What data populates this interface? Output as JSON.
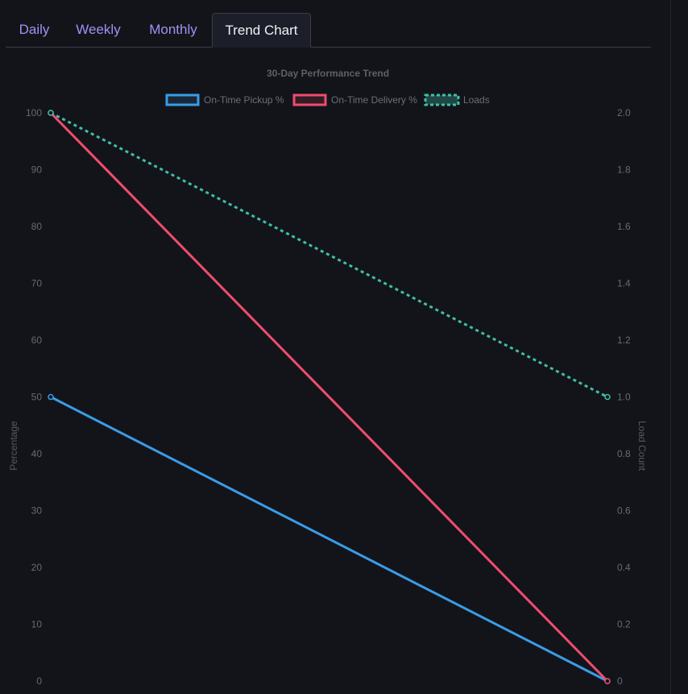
{
  "tabs": [
    {
      "label": "Daily",
      "active": false
    },
    {
      "label": "Weekly",
      "active": false
    },
    {
      "label": "Monthly",
      "active": false
    },
    {
      "label": "Trend Chart",
      "active": true
    }
  ],
  "colors": {
    "pickup": "#3a9ce6",
    "delivery": "#ef4d6e",
    "loads": "#3fbfa9",
    "tab_link": "#a38ff5"
  },
  "chart_data": {
    "type": "line",
    "title": "30-Day Performance Trend",
    "x": [
      "",
      ""
    ],
    "y_left": {
      "label": "Percentage",
      "range": [
        0,
        100
      ],
      "ticks": [
        0,
        10,
        20,
        30,
        40,
        50,
        60,
        70,
        80,
        90,
        100
      ]
    },
    "y_right": {
      "label": "Load Count",
      "range": [
        0,
        2
      ],
      "ticks": [
        "0",
        "0.2",
        "0.4",
        "0.6",
        "0.8",
        "1.0",
        "1.2",
        "1.4",
        "1.6",
        "1.8",
        "2.0"
      ]
    },
    "legend_position": "top-center",
    "series": [
      {
        "name": "On-Time Pickup %",
        "axis": "left",
        "values": [
          50,
          0
        ],
        "style": "solid"
      },
      {
        "name": "On-Time Delivery %",
        "axis": "left",
        "values": [
          100,
          0
        ],
        "style": "solid"
      },
      {
        "name": "Loads",
        "axis": "right",
        "values": [
          2,
          1
        ],
        "style": "dashed"
      }
    ]
  }
}
